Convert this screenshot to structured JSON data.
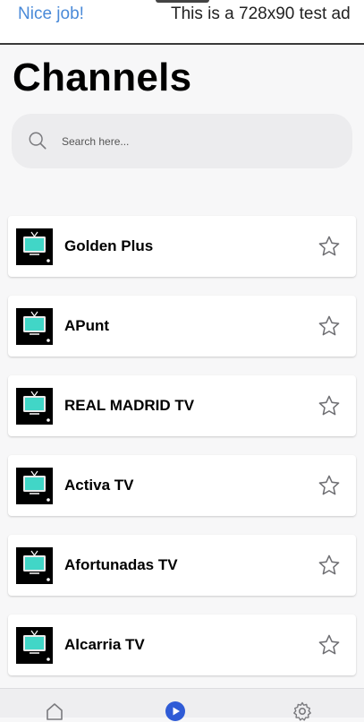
{
  "ad": {
    "nice_job": "Nice job!",
    "text": "This is a 728x90 test ad"
  },
  "header": {
    "title": "Channels"
  },
  "search": {
    "placeholder": "Search here...",
    "value": "",
    "icon": "search-icon"
  },
  "channels": [
    {
      "name": "Golden Plus",
      "icon": "tv-icon",
      "favorite": false
    },
    {
      "name": "APunt",
      "icon": "tv-icon",
      "favorite": false
    },
    {
      "name": "REAL MADRID TV",
      "icon": "tv-icon",
      "favorite": false
    },
    {
      "name": "Activa TV",
      "icon": "tv-icon",
      "favorite": false
    },
    {
      "name": "Afortunadas TV",
      "icon": "tv-icon",
      "favorite": false
    },
    {
      "name": "Alcarria TV",
      "icon": "tv-icon",
      "favorite": false
    }
  ],
  "nav": {
    "items": [
      {
        "name": "home",
        "icon": "home-icon",
        "active": false
      },
      {
        "name": "player",
        "icon": "play-icon",
        "active": true
      },
      {
        "name": "settings",
        "icon": "gear-icon",
        "active": false
      }
    ]
  },
  "colors": {
    "accent": "#2f5bd6",
    "ad_link": "#4a8ad8",
    "tv_screen": "#41d6c7"
  }
}
